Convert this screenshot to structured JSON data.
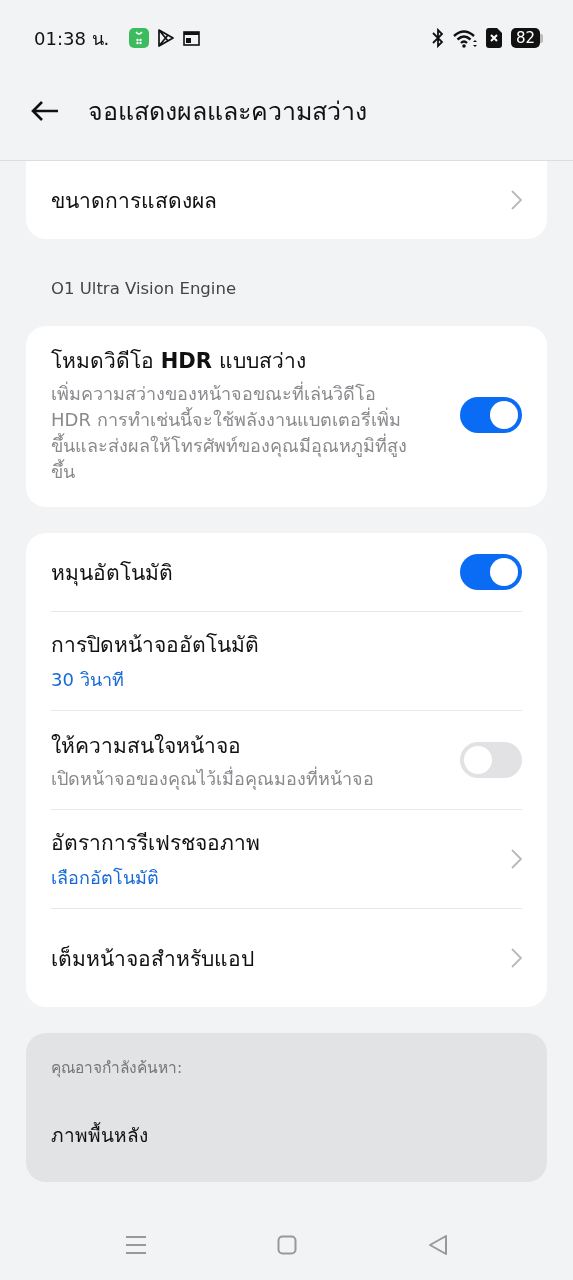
{
  "status_bar": {
    "time": "01:38 น.",
    "battery": "82"
  },
  "header": {
    "title": "จอแสดงผลและความสว่าง"
  },
  "sections": [
    {
      "items": [
        {
          "kind": "nav",
          "title": "ขนาดการแสดงผล"
        }
      ]
    },
    {
      "heading": "O1 Ultra Vision Engine",
      "items": [
        {
          "kind": "toggle",
          "title": "โหมดวิดีโอ **HDR** แบบสว่าง",
          "description": "เพิ่มความสว่างของหน้าจอขณะที่เล่นวิดีโอ HDR การทำเช่นนี้จะใช้พลังงานแบตเตอรี่เพิ่มขึ้นและส่งผลให้โทรศัพท์ของคุณมีอุณหภูมิที่สูงขึ้น",
          "on": true
        }
      ]
    },
    {
      "items": [
        {
          "kind": "toggle",
          "title": "หมุนอัตโนมัติ",
          "on": true
        },
        {
          "kind": "value",
          "title": "การปิดหน้าจออัตโนมัติ",
          "value": "30 วินาที"
        },
        {
          "kind": "toggle",
          "title": "ให้ความสนใจหน้าจอ",
          "description": "เปิดหน้าจอของคุณไว้เมื่อคุณมองที่หน้าจอ",
          "on": false
        },
        {
          "kind": "nav",
          "title": "อัตราการรีเฟรชจอภาพ",
          "value": "เลือกอัตโนมัติ"
        },
        {
          "kind": "nav",
          "title": "เต็มหน้าจอสำหรับแอป"
        }
      ]
    }
  ],
  "suggestions": {
    "heading": "คุณอาจกำลังค้นหา:",
    "items": [
      "ภาพพื้นหลัง"
    ]
  }
}
